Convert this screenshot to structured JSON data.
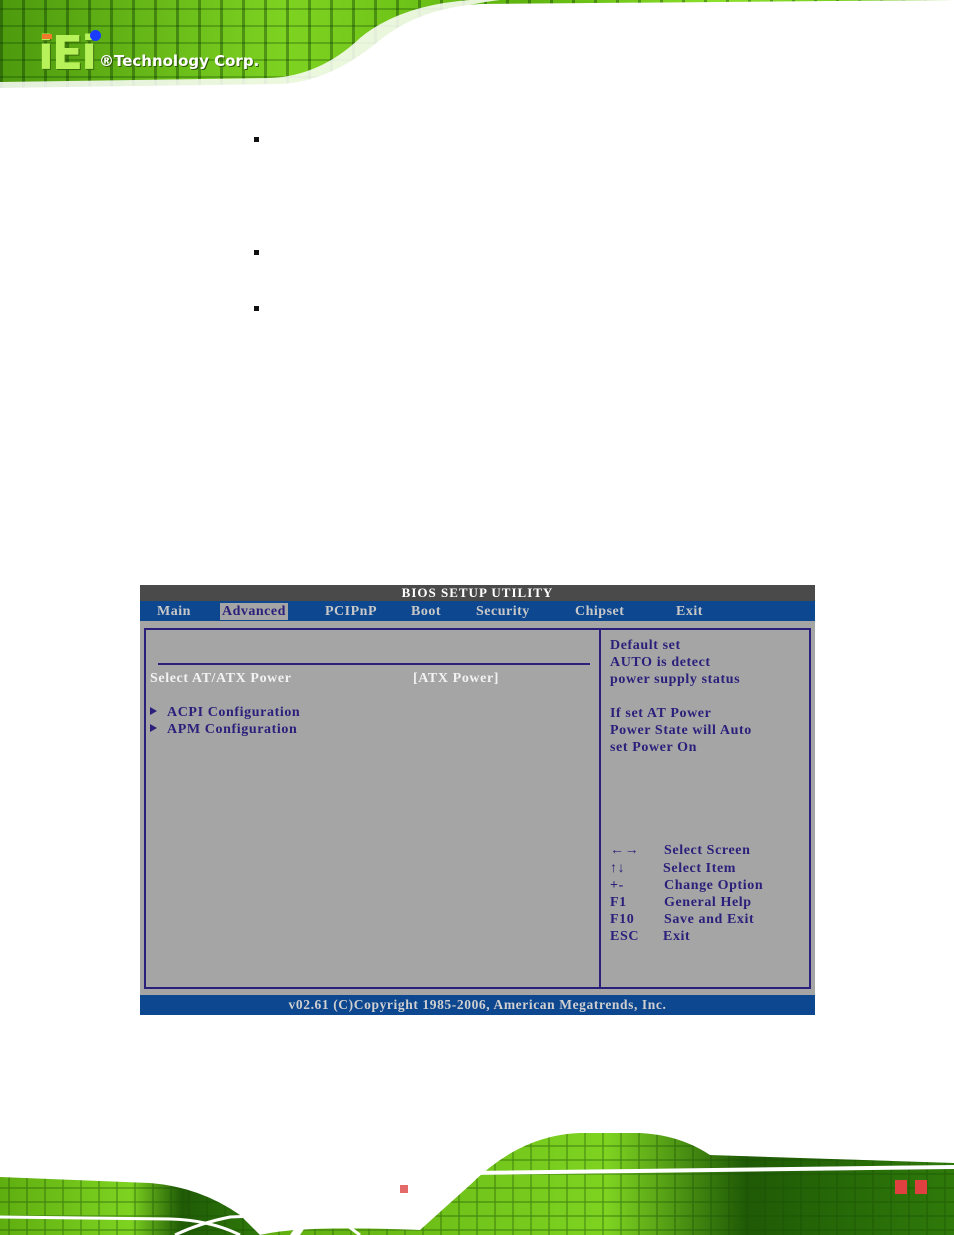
{
  "header": {
    "logo_letters": "iEi",
    "logo_text": "®Technology Corp."
  },
  "bios": {
    "title": "BIOS SETUP UTILITY",
    "tabs": [
      {
        "label": "Main",
        "active": false
      },
      {
        "label": "Advanced",
        "active": true
      },
      {
        "label": "PCIPnP",
        "active": false
      },
      {
        "label": "Boot",
        "active": false
      },
      {
        "label": "Security",
        "active": false
      },
      {
        "label": "Chipset",
        "active": false
      },
      {
        "label": "Exit",
        "active": false
      }
    ],
    "option": {
      "label": "Select AT/ATX Power",
      "value": "[ATX Power]"
    },
    "submenus": [
      {
        "label": "ACPI Configuration"
      },
      {
        "label": "APM Configuration"
      }
    ],
    "help_lines": [
      "Default set",
      "AUTO is detect",
      "power supply status",
      "",
      "If set AT Power",
      "Power State will Auto",
      "set Power On"
    ],
    "keys": [
      {
        "key": "←→",
        "action": "Select Screen"
      },
      {
        "key": "↑↓",
        "action": "Select Item"
      },
      {
        "key": "+-",
        "action": "Change Option"
      },
      {
        "key": "F1",
        "action": "General Help"
      },
      {
        "key": "F10",
        "action": "Save and Exit"
      },
      {
        "key": "ESC",
        "action": "Exit"
      }
    ],
    "footer": "v02.61 (C)Copyright 1985-2006, American Megatrends, Inc."
  },
  "colors": {
    "bios_bg": "#a5a5a5",
    "bios_blue": "#0d4790",
    "bios_title_bg": "#4a4a4a",
    "bios_text_dark": "#2a1f7a",
    "pcb_green": "#7ed321"
  }
}
